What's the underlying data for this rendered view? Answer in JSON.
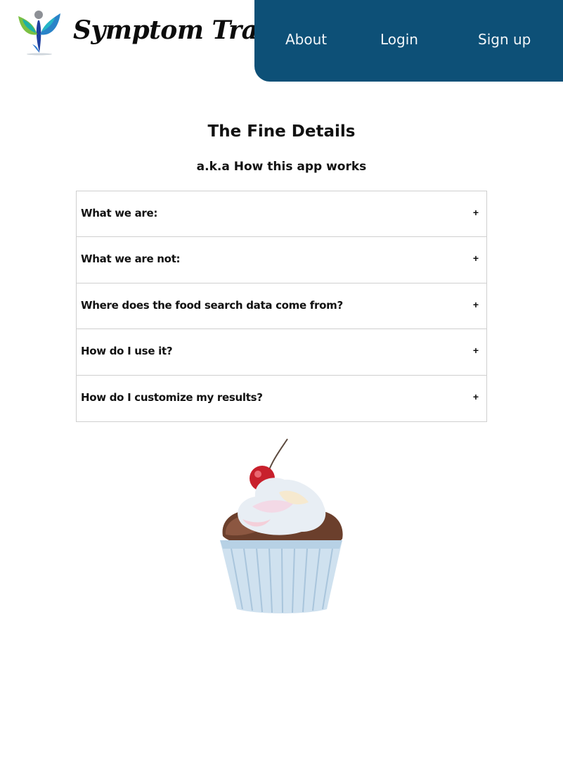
{
  "brand": {
    "name": "Symptom Tracker",
    "logo_icon": "person-leaves-logo-icon"
  },
  "nav": {
    "about": "About",
    "login": "Login",
    "signup": "Sign up",
    "background_color": "#0d5077"
  },
  "main": {
    "title": "The Fine Details",
    "subtitle": "a.k.a How this app works",
    "faq": [
      {
        "question": "What we are:",
        "toggle": "+"
      },
      {
        "question": "What we are not:",
        "toggle": "+"
      },
      {
        "question": "Where does the food search data come from?",
        "toggle": "+"
      },
      {
        "question": "How do I use it?",
        "toggle": "+"
      },
      {
        "question": "How do I customize my results?",
        "toggle": "+"
      }
    ],
    "illustration": "cupcake-illustration"
  }
}
